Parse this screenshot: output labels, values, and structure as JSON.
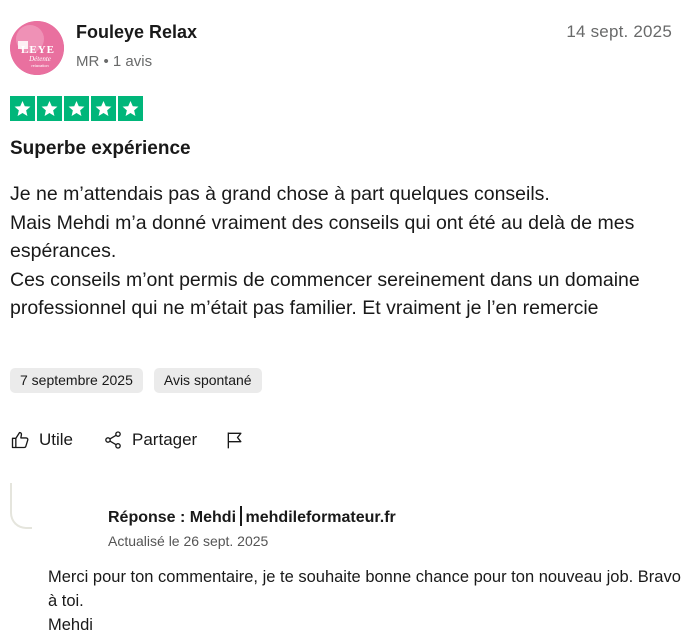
{
  "reviewer": {
    "name": "Fouleye Relax",
    "meta": "MR • 1 avis",
    "avatar_logo_text": [
      "LEYE",
      "Détente",
      "relaxation"
    ]
  },
  "review": {
    "date": "14 sept. 2025",
    "rating": 5,
    "title": "Superbe expérience",
    "body": "Je ne m’attendais pas à grand chose à part quelques conseils.\nMais Mehdi m’a donné vraiment des conseils qui ont été au delà de mes espérances.\nCes conseils m’ont permis de commencer sereinement dans un domaine professionnel qui ne m’était pas familier. Et vraiment je l’en remercie",
    "experience_date": "7 septembre 2025",
    "badge": "Avis spontané"
  },
  "actions": {
    "useful": "Utile",
    "share": "Partager"
  },
  "reply": {
    "title": "Réponse : Mehdi",
    "company": "mehdileformateur.fr",
    "updated": "Actualisé le 26 sept. 2025",
    "body": "Merci pour ton commentaire, je te souhaite bonne chance pour ton nouveau job. Bravo à toi.\nMehdi"
  },
  "colors": {
    "star_green": "#00b67a",
    "muted_text": "#696a6a",
    "chip_bg": "#ebebeb"
  },
  "icons": [
    "star-icon",
    "thumbs-up-icon",
    "share-icon",
    "flag-icon"
  ]
}
